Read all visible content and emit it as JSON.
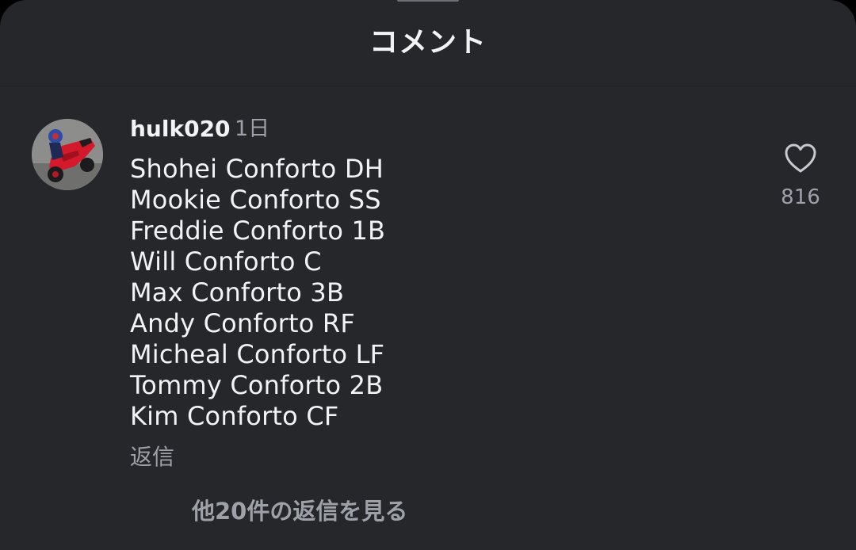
{
  "sheet": {
    "title": "コメント"
  },
  "comment": {
    "username": "hulk020",
    "timestamp": "1日",
    "lines": [
      "Shohei Conforto DH",
      "Mookie Conforto SS",
      "Freddie Conforto 1B",
      "Will Conforto C",
      "Max Conforto 3B",
      "Andy Conforto RF",
      "Micheal Conforto LF",
      "Tommy Conforto 2B",
      "Kim Conforto CF"
    ],
    "reply_label": "返信",
    "like_icon": "heart-outline-icon",
    "like_count": "816",
    "view_replies_label": "他20件の返信を見る"
  },
  "colors": {
    "sheet_background": "#25272b",
    "primary_text": "#f2f3f5",
    "secondary_text": "#9ea2a8"
  }
}
